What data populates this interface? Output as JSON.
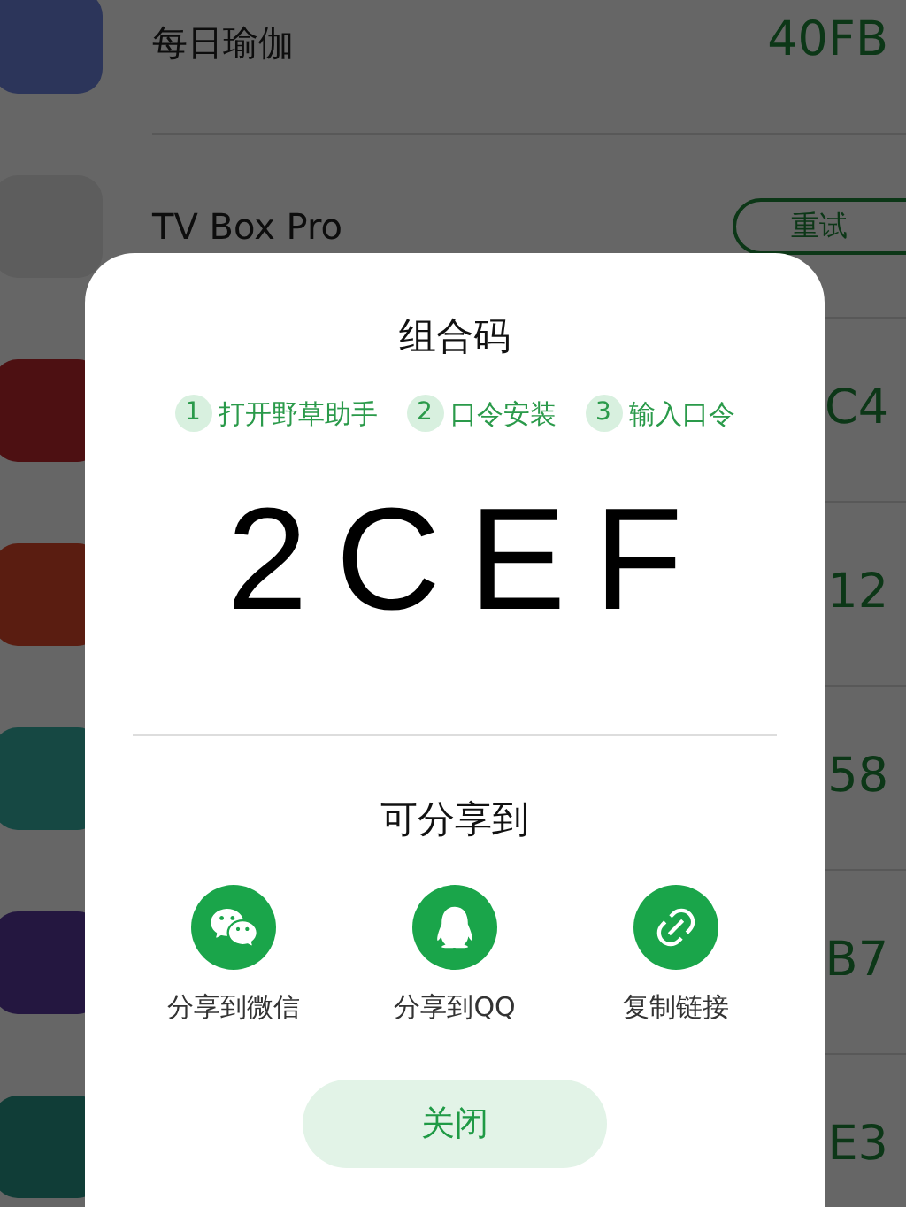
{
  "apps": [
    {
      "kind": "code",
      "name": "每日瑜伽",
      "code": "40FB"
    },
    {
      "kind": "retry",
      "name": "TV Box Pro",
      "action": "重试"
    },
    {
      "kind": "code",
      "code": "C4"
    },
    {
      "kind": "code",
      "code": "12"
    },
    {
      "kind": "code",
      "code": "58"
    },
    {
      "kind": "code",
      "code": "B7"
    },
    {
      "kind": "code",
      "code": "E3"
    }
  ],
  "dialog": {
    "title": "组合码",
    "steps": [
      {
        "number": "1",
        "label": "打开野草助手"
      },
      {
        "number": "2",
        "label": "口令安装"
      },
      {
        "number": "3",
        "label": "输入口令"
      }
    ],
    "code": "2CEF",
    "share_title": "可分享到",
    "share_options": [
      {
        "kind": "wechat",
        "label": "分享到微信"
      },
      {
        "kind": "qq",
        "label": "分享到QQ"
      },
      {
        "kind": "link",
        "label": "复制链接"
      }
    ],
    "close_button": "关闭"
  }
}
